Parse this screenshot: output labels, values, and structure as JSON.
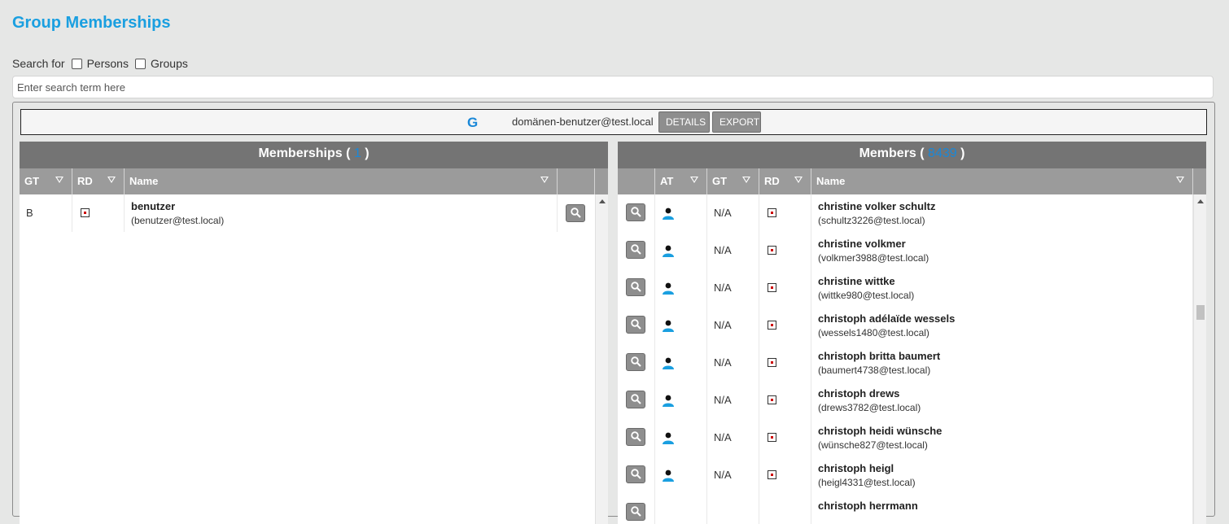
{
  "page": {
    "title": "Group Memberships"
  },
  "search": {
    "label": "Search for",
    "option_persons": "Persons",
    "option_groups": "Groups",
    "placeholder": "Enter search term here"
  },
  "group": {
    "type_icon": "G",
    "name": "domänen-benutzer@test.local",
    "details_label": "DETAILS",
    "export_label": "EXPORT"
  },
  "memberships": {
    "title": "Memberships",
    "open_paren": "(",
    "count": "1",
    "close_paren": ")",
    "columns": {
      "gt": "GT",
      "rd": "RD",
      "name": "Name"
    },
    "rows": [
      {
        "gt": "B",
        "name": "benutzer",
        "sub": "(benutzer@test.local)"
      }
    ]
  },
  "members": {
    "title": "Members",
    "open_paren": "(",
    "count": "8439",
    "close_paren": ")",
    "columns": {
      "at": "AT",
      "gt": "GT",
      "rd": "RD",
      "name": "Name"
    },
    "rows": [
      {
        "gt": "N/A",
        "name": "christine volker schultz",
        "sub": "(schultz3226@test.local)"
      },
      {
        "gt": "N/A",
        "name": "christine volkmer",
        "sub": "(volkmer3988@test.local)"
      },
      {
        "gt": "N/A",
        "name": "christine wittke",
        "sub": "(wittke980@test.local)"
      },
      {
        "gt": "N/A",
        "name": "christoph adélaïde wessels",
        "sub": "(wessels1480@test.local)"
      },
      {
        "gt": "N/A",
        "name": "christoph britta baumert",
        "sub": "(baumert4738@test.local)"
      },
      {
        "gt": "N/A",
        "name": "christoph drews",
        "sub": "(drews3782@test.local)"
      },
      {
        "gt": "N/A",
        "name": "christoph heidi wünsche",
        "sub": "(wünsche827@test.local)"
      },
      {
        "gt": "N/A",
        "name": "christoph heigl",
        "sub": "(heigl4331@test.local)"
      },
      {
        "gt": "",
        "name": "christoph herrmann",
        "sub": ""
      }
    ]
  },
  "icons": {
    "search": "magnifier-icon",
    "person": "person-icon",
    "filter": "filter-icon",
    "rd": "checkbox-marker-icon"
  },
  "colors": {
    "accent": "#1a9fe0",
    "header_dark": "#747474",
    "header_light": "#9b9b9b",
    "button": "#8e8e8e"
  }
}
